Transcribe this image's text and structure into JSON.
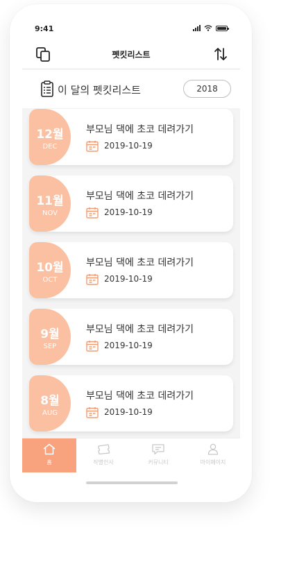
{
  "status_bar": {
    "time": "9:41"
  },
  "nav": {
    "title": "펫킷리스트"
  },
  "month_header": {
    "title": "이 달의 펫킷리스트",
    "year": "2018"
  },
  "cards": [
    {
      "month": "12월",
      "abbr": "DEC",
      "title": "부모님 댁에 초코 데려가기",
      "date": "2019-10-19"
    },
    {
      "month": "11월",
      "abbr": "NOV",
      "title": "부모님 댁에 초코 데려가기",
      "date": "2019-10-19"
    },
    {
      "month": "10월",
      "abbr": "OCT",
      "title": "부모님 댁에 초코 데려가기",
      "date": "2019-10-19"
    },
    {
      "month": "9월",
      "abbr": "SEP",
      "title": "부모님 댁에 초코 데려가기",
      "date": "2019-10-19"
    },
    {
      "month": "8월",
      "abbr": "AUG",
      "title": "부모님 댁에 초코 데려가기",
      "date": "2019-10-19"
    }
  ],
  "tabs": [
    {
      "label": "홈",
      "icon": "home-icon",
      "active": true
    },
    {
      "label": "작별인사",
      "icon": "ticket-icon",
      "active": false
    },
    {
      "label": "커뮤니티",
      "icon": "chat-icon",
      "active": false
    },
    {
      "label": "마이페이지",
      "icon": "person-icon",
      "active": false
    }
  ],
  "colors": {
    "accent": "#f9a37e",
    "badge": "#fbbfa2",
    "icon_accent": "#f49a6f"
  }
}
